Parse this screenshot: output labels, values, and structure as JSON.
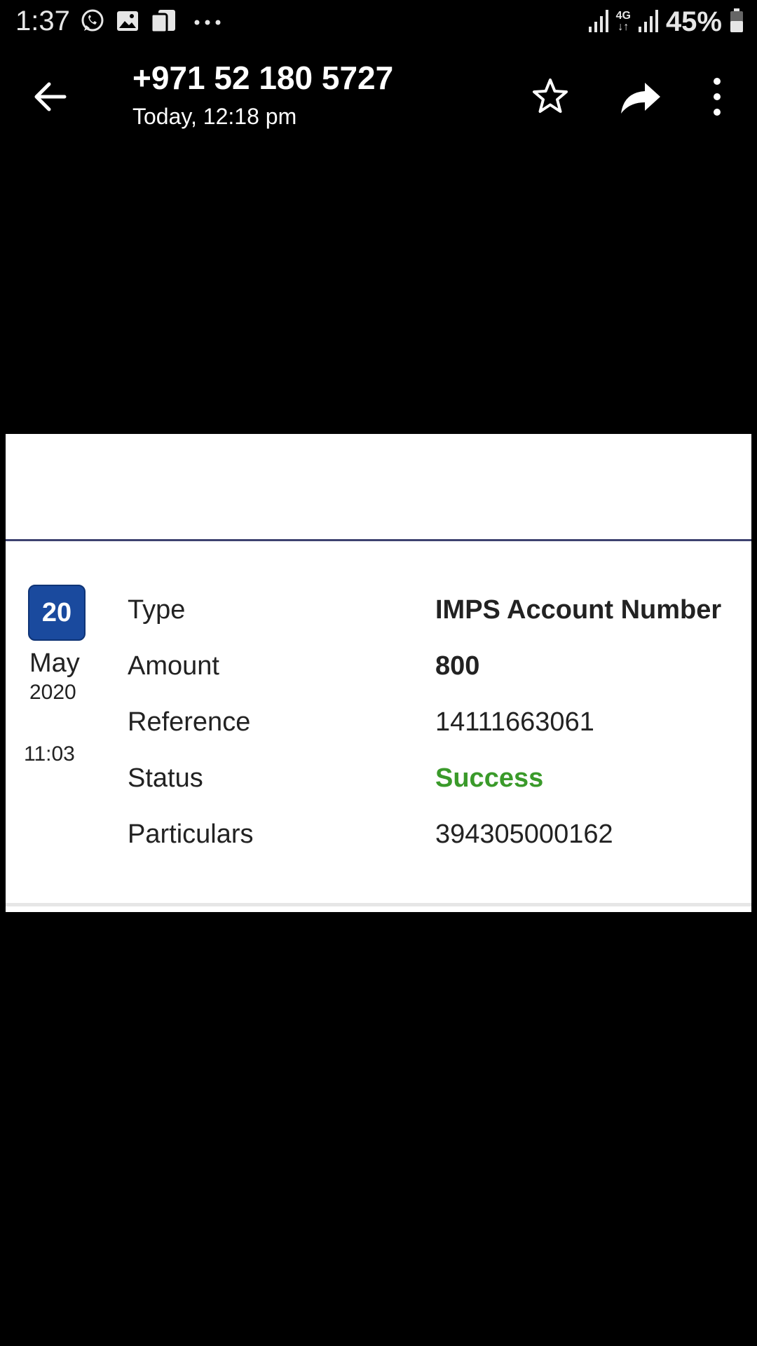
{
  "status_bar": {
    "time": "1:37",
    "battery": "45%",
    "icons": [
      "whatsapp-icon",
      "gallery-icon",
      "files-icon",
      "more-notifications-icon",
      "signal-icon",
      "4g-icon",
      "signal-icon",
      "battery-icon"
    ],
    "network_label": "4G"
  },
  "header": {
    "title": "+971 52 180 5727",
    "subtitle": "Today, 12:18 pm"
  },
  "transaction": {
    "day": "20",
    "month": "May",
    "year": "2020",
    "time": "11:03",
    "rows": [
      {
        "label": "Type",
        "value": "IMPS Account Number"
      },
      {
        "label": "Amount",
        "value": "800"
      },
      {
        "label": "Reference",
        "value": "14111663061"
      },
      {
        "label": "Status",
        "value": "Success"
      },
      {
        "label": "Particulars",
        "value": "394305000162"
      }
    ]
  },
  "colors": {
    "background": "#000000",
    "card": "#ffffff",
    "date_badge": "#1a4a9e",
    "divider": "#3e4270",
    "success": "#3a9a2a"
  }
}
